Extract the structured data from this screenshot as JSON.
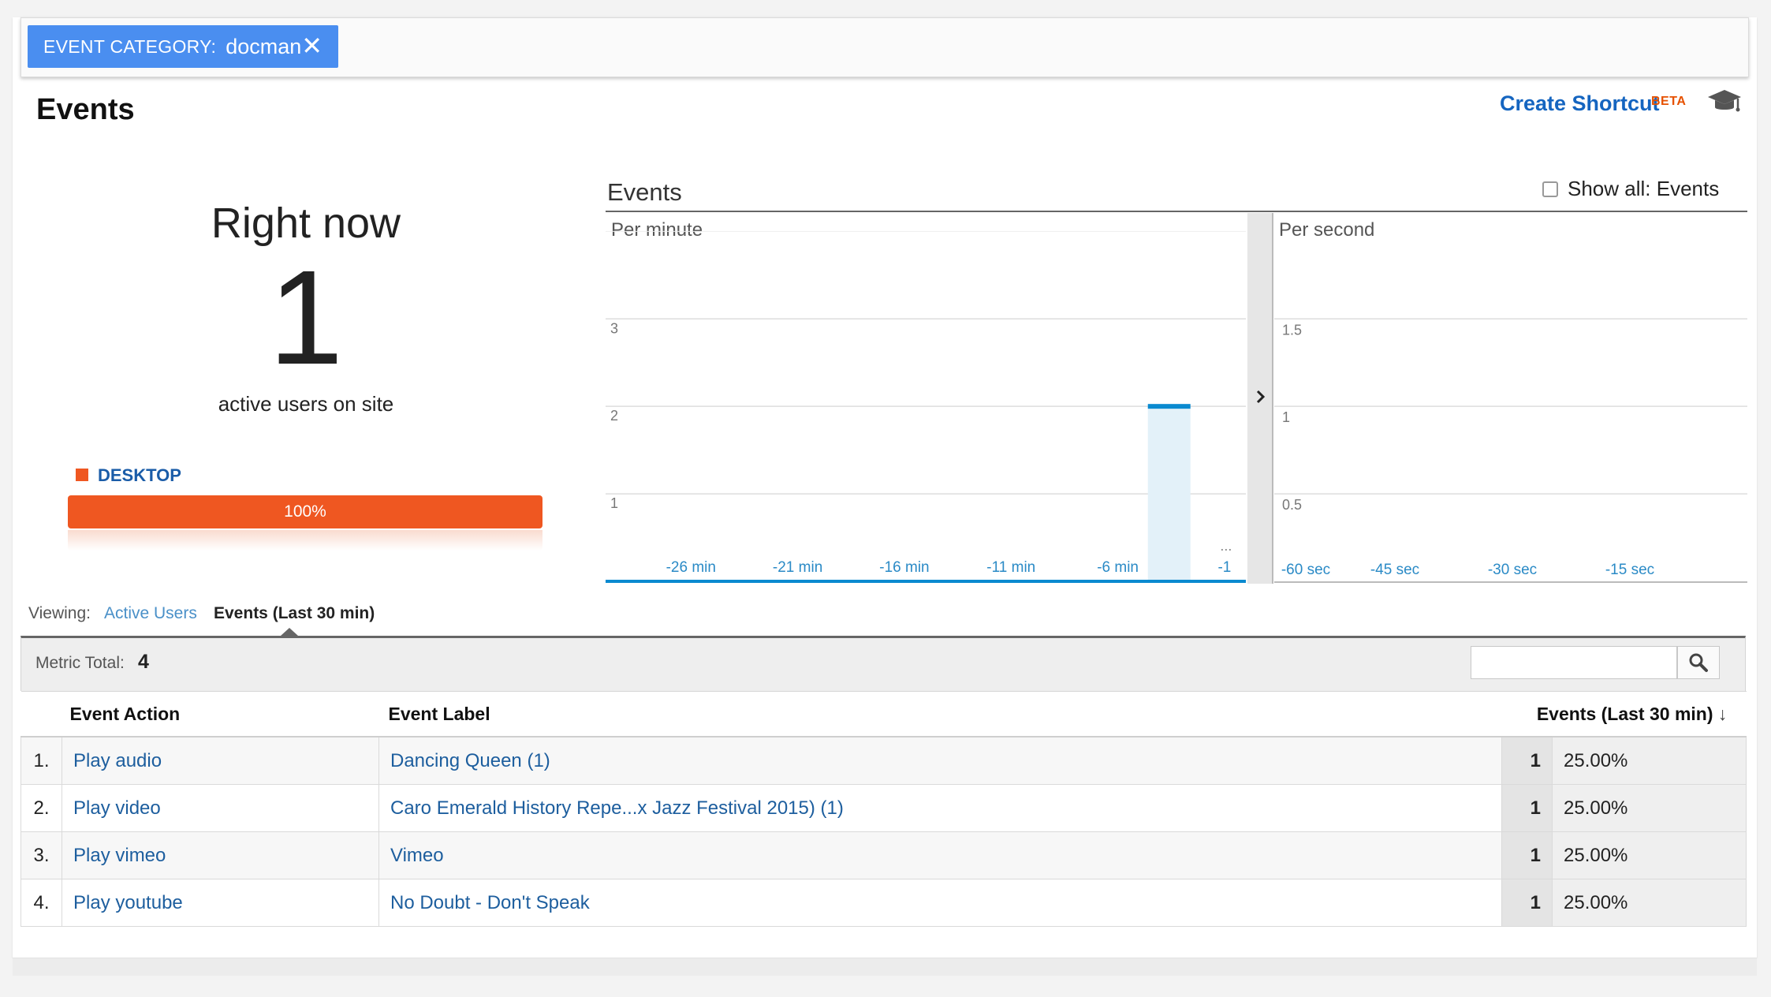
{
  "filter": {
    "key": "EVENT CATEGORY:",
    "value": "docman",
    "close_icon": "close-icon"
  },
  "header": {
    "title": "Events",
    "shortcut_label": "Create Shortcut",
    "beta_badge": "BETA",
    "tutorial_icon": "graduation-cap-icon"
  },
  "summary": {
    "right_now_label": "Right now",
    "active_count": "1",
    "active_sublabel": "active users on site",
    "device_label": "DESKTOP",
    "device_percent_label": "100%",
    "device_percent_value": 100,
    "device_color": "#ef5721"
  },
  "chart": {
    "title": "Events",
    "show_all_label": "Show all: Events",
    "show_all_checked": false,
    "expand_icon": "chevron-right-icon"
  },
  "chart_data": [
    {
      "type": "bar",
      "title": "Per minute",
      "x_ticks": [
        "-26 min",
        "-21 min",
        "-16 min",
        "-11 min",
        "-6 min",
        "-1"
      ],
      "ellipsis": "...",
      "y_ticks": [
        "1",
        "2",
        "3"
      ],
      "ylim": [
        0,
        4
      ],
      "bars": [
        {
          "x": -4,
          "value": 2
        }
      ],
      "grid": true,
      "color": "#0a8ad0"
    },
    {
      "type": "bar",
      "title": "Per second",
      "x_ticks": [
        "-60 sec",
        "-45 sec",
        "-30 sec",
        "-15 sec"
      ],
      "y_ticks": [
        "0.5",
        "1",
        "1.5"
      ],
      "ylim": [
        0,
        2
      ],
      "bars": [],
      "grid": true,
      "color": "#0a8ad0"
    }
  ],
  "viewing": {
    "label": "Viewing:",
    "options": [
      "Active Users",
      "Events (Last 30 min)"
    ],
    "selected": "Events (Last 30 min)"
  },
  "metric": {
    "label": "Metric Total:",
    "value": "4",
    "search_placeholder": "",
    "search_icon": "search-icon"
  },
  "table": {
    "columns": [
      "Event Action",
      "Event Label",
      "Events (Last 30 min)"
    ],
    "sort_icon": "arrow-down-icon",
    "rows": [
      {
        "index": "1.",
        "action": "Play audio",
        "label": "Dancing Queen (1)",
        "value": "1",
        "percent": "25.00%"
      },
      {
        "index": "2.",
        "action": "Play video",
        "label": "Caro Emerald History Repe...x Jazz Festival 2015) (1)",
        "value": "1",
        "percent": "25.00%"
      },
      {
        "index": "3.",
        "action": "Play vimeo",
        "label": "Vimeo",
        "value": "1",
        "percent": "25.00%"
      },
      {
        "index": "4.",
        "action": "Play youtube",
        "label": "No Doubt - Don't Speak",
        "value": "1",
        "percent": "25.00%"
      }
    ]
  }
}
